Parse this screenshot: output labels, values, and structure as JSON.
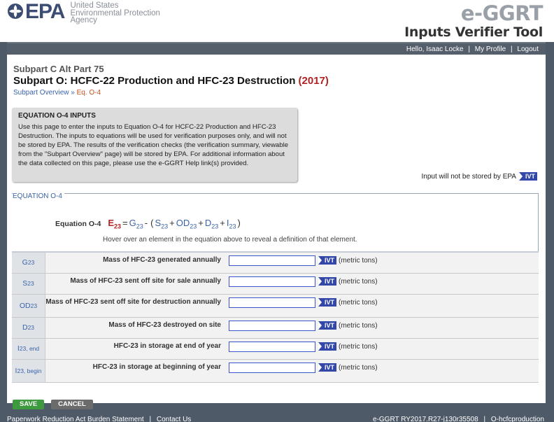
{
  "header": {
    "agency_mark": "EPA",
    "agency_line1": "United States",
    "agency_line2": "Environmental Protection",
    "agency_line3": "Agency",
    "brand": "e-GGRT",
    "tool": "Inputs Verifier Tool"
  },
  "userbar": {
    "greeting": "Hello, Isaac Locke",
    "profile": "My Profile",
    "logout": "Logout"
  },
  "page": {
    "subpart_label": "Subpart C Alt Part 75",
    "title": "Subpart O: HCFC-22 Production and HFC-23 Destruction",
    "year": "(2017)",
    "breadcrumb_link": "Subpart Overview",
    "breadcrumb_sep": "»",
    "breadcrumb_current": "Eq. O-4"
  },
  "info": {
    "heading": "EQUATION O-4 INPUTS",
    "body": "Use this page to enter the inputs to Equation O-4 for HCFC-22 Production and HFC-23 Destruction. The inputs to equations will be used for verification purposes only, and will not be stored by EPA. The results of the verification checks (the verification summary, viewable from the \"Subpart Overview\" page) will be stored by EPA. For additional information about the data collected on this page, please use the e-GGRT Help link(s) provided."
  },
  "note": {
    "text": "Input will not be stored by EPA",
    "badge": "IVT"
  },
  "equation": {
    "section_label": "EQUATION O-4",
    "name": "Equation O-4",
    "lhs": "E",
    "lhs_sub": "23",
    "eq_sign": "=",
    "g": "G",
    "g_sub": "23",
    "minus": "-",
    "open": "(",
    "s": "S",
    "s_sub": "23",
    "plus1": "+",
    "od": "OD",
    "od_sub": "23",
    "plus2": "+",
    "d": "D",
    "d_sub": "23",
    "plus3": "+",
    "i": "I",
    "i_sub": "23",
    "close": ")",
    "hint": "Hover over an element in the equation above to reveal a definition of that element."
  },
  "rows": [
    {
      "sym": "G",
      "sub": "23",
      "label": "Mass of HFC-23 generated annually",
      "value": "",
      "badge": "IVT",
      "unit": "(metric tons)"
    },
    {
      "sym": "S",
      "sub": "23",
      "label": "Mass of HFC-23 sent off site for sale annually",
      "value": "",
      "badge": "IVT",
      "unit": "(metric tons)"
    },
    {
      "sym": "OD",
      "sub": "23",
      "label": "Mass of HFC-23 sent off site for destruction annually",
      "value": "",
      "badge": "IVT",
      "unit": "(metric tons)"
    },
    {
      "sym": "D",
      "sub": "23",
      "label": "Mass of HFC-23 destroyed on site",
      "value": "",
      "badge": "IVT",
      "unit": "(metric tons)"
    },
    {
      "sym": "I",
      "sub": "23, end",
      "label": "HFC-23 in storage at end of year",
      "value": "",
      "badge": "IVT",
      "unit": "(metric tons)"
    },
    {
      "sym": "I",
      "sub": "23, begin",
      "label": "HFC-23 in storage at beginning of year",
      "value": "",
      "badge": "IVT",
      "unit": "(metric tons)"
    }
  ],
  "buttons": {
    "save": "SAVE",
    "cancel": "CANCEL"
  },
  "footer": {
    "burden": "Paperwork Reduction Act Burden Statement",
    "contact": "Contact Us",
    "version": "e-GGRT RY2017.R27-j130r35508",
    "page_id": "O-hcfcproduction"
  },
  "colors": {
    "accent_blue": "#3a63a8",
    "year_red": "#b22222",
    "ivt_badge": "#3347a8",
    "frame": "#4f5a68",
    "save_green": "#3e9a3e"
  }
}
